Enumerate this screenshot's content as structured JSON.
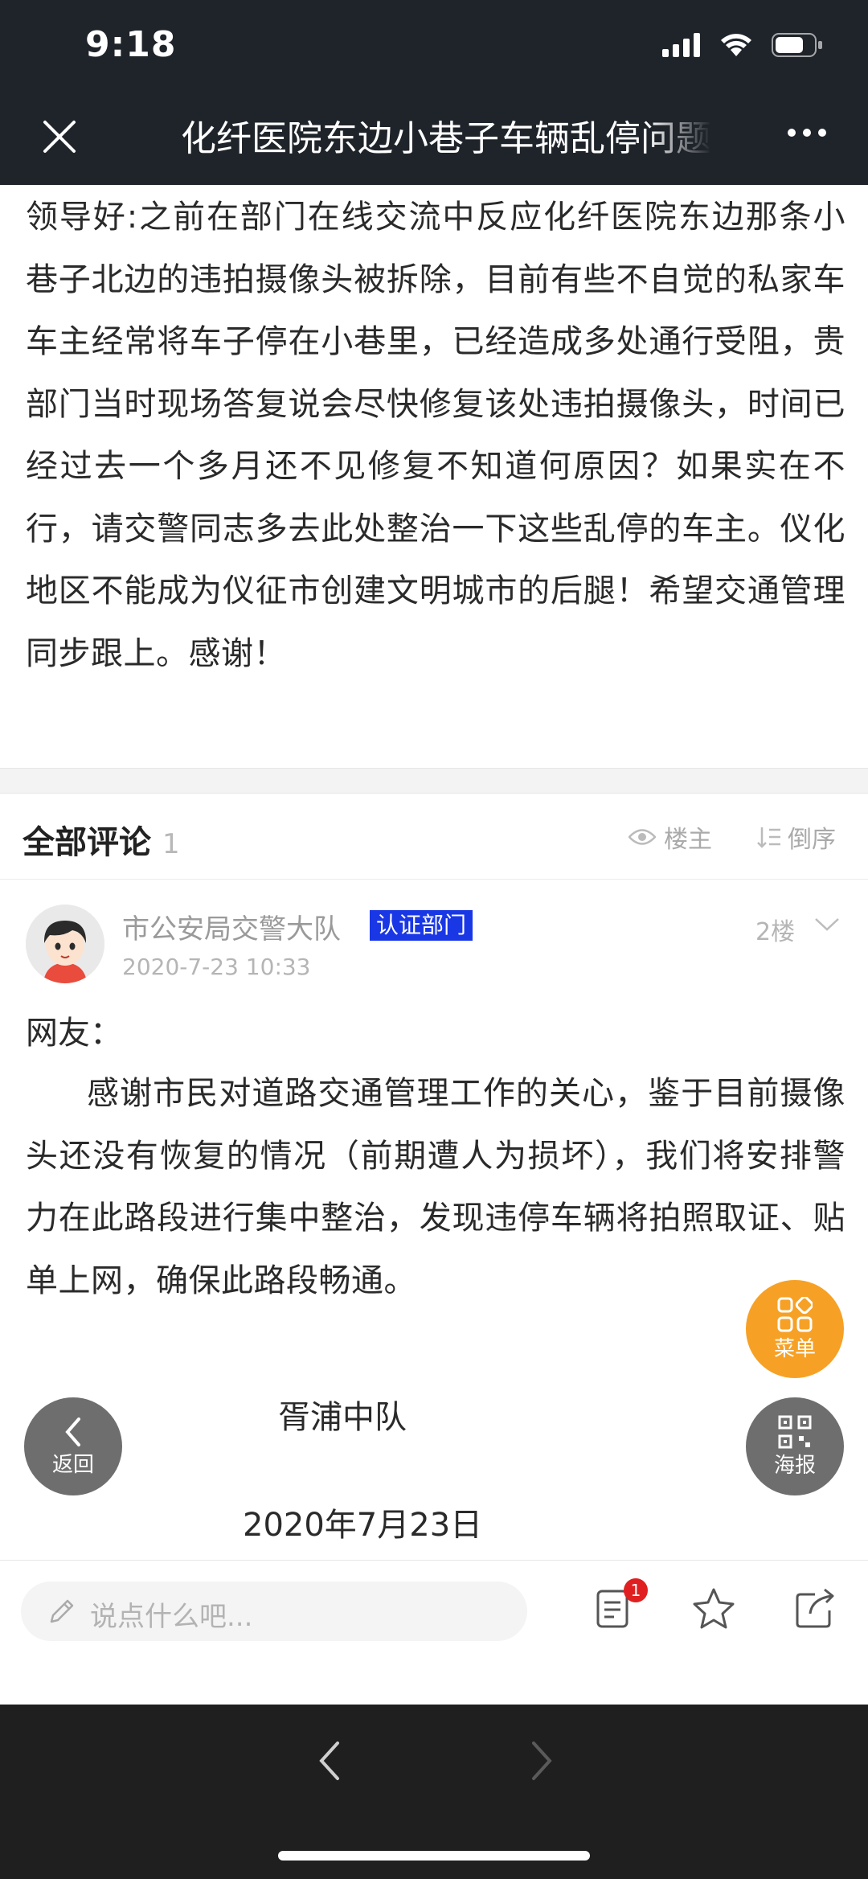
{
  "status": {
    "time": "9:18"
  },
  "nav": {
    "title": "化纤医院东边小巷子车辆乱停问题"
  },
  "article": {
    "body": "领导好:之前在部门在线交流中反应化纤医院东边那条小巷子北边的违拍摄像头被拆除，目前有些不自觉的私家车车主经常将车子停在小巷里，已经造成多处通行受阻，贵部门当时现场答复说会尽快修复该处违拍摄像头，时间已经过去一个多月还不见修复不知道何原因？如果实在不行，请交警同志多去此处整治一下这些乱停的车主。仪化地区不能成为仪征市创建文明城市的后腿！希望交通管理同步跟上。感谢！"
  },
  "comments_header": {
    "title": "全部评论",
    "count": "1",
    "owner_only": "楼主",
    "order": "倒序"
  },
  "comment": {
    "author": "市公安局交警大队",
    "badge": "认证部门",
    "time": "2020-7-23 10:33",
    "floor": "2楼",
    "greeting": "网友：",
    "body": "感谢市民对道路交通管理工作的关心，鉴于目前摄像头还没有恢复的情况（前期遭人为损坏），我们将安排警力在此路段进行集中整治，发现违停车辆将拍照取证、贴单上网，确保此路段畅通。",
    "signature": "胥浦中队",
    "date": "2020年7月23日"
  },
  "fabs": {
    "menu": "菜单",
    "back": "返回",
    "poster": "海报"
  },
  "bottom_bar": {
    "input_placeholder": "说点什么吧...",
    "comment_badge": "1"
  },
  "colors": {
    "topbar": "#1f242b",
    "badge_blue": "#1a37e6",
    "menu_orange": "#f6a126",
    "fab_gray": "#6e6e6e",
    "notify_red": "#e02020"
  }
}
